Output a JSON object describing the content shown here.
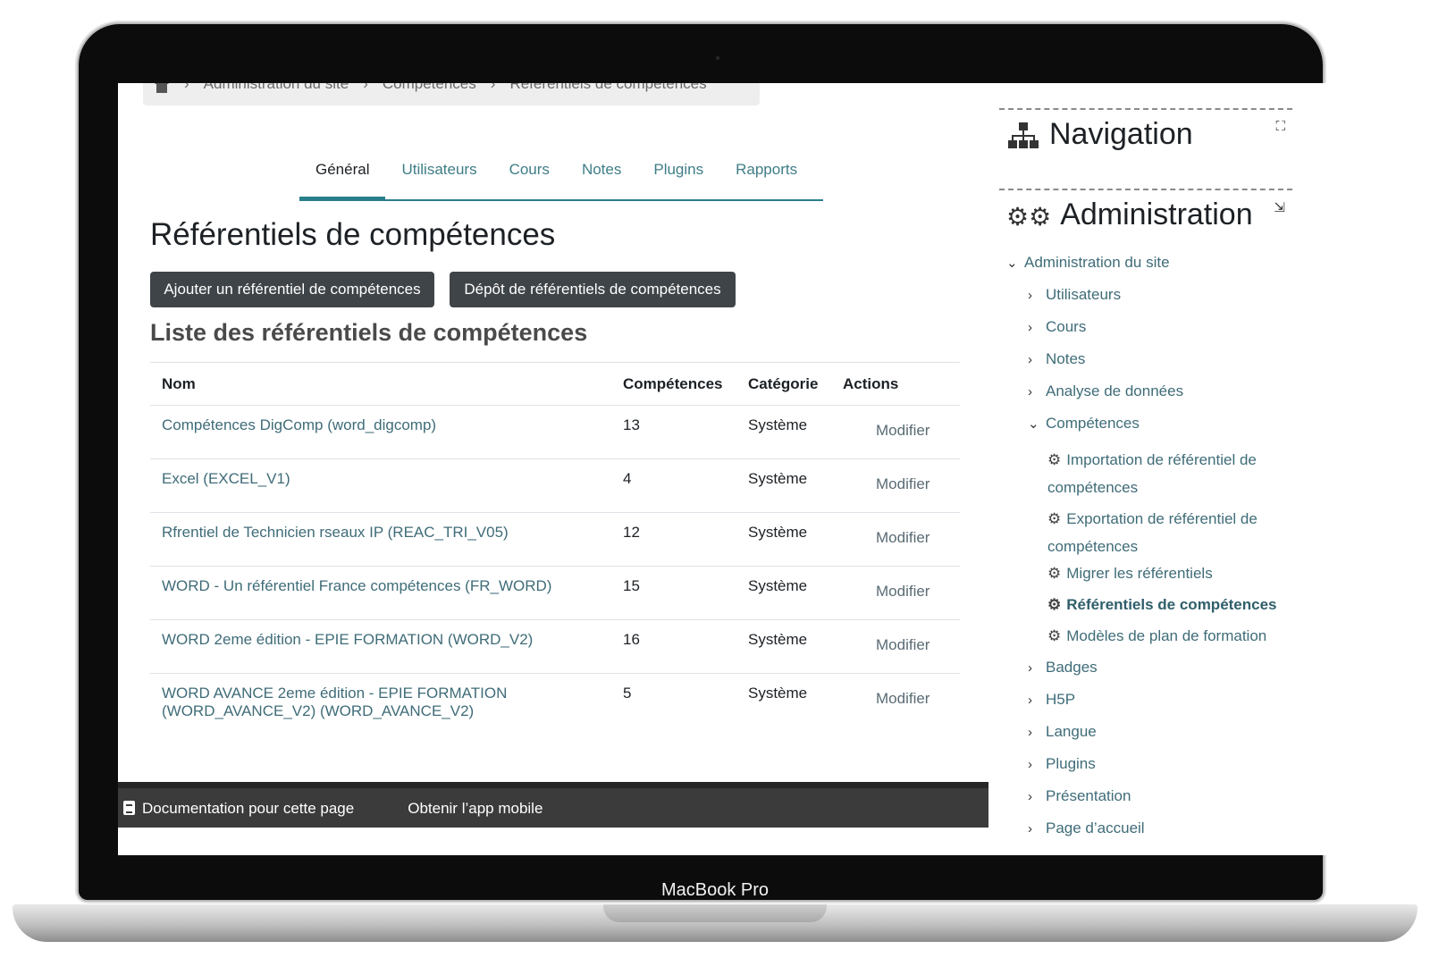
{
  "device": {
    "label": "MacBook Pro"
  },
  "breadcrumb": {
    "items": [
      "Administration du site",
      "Compétences",
      "Référentiels de compétences"
    ],
    "separator": "›"
  },
  "tabs": [
    {
      "label": "Général"
    },
    {
      "label": "Utilisateurs"
    },
    {
      "label": "Cours"
    },
    {
      "label": "Notes"
    },
    {
      "label": "Plugins"
    },
    {
      "label": "Rapports"
    }
  ],
  "main": {
    "title": "Référentiels de compétences",
    "add_button": "Ajouter un référentiel de compétences",
    "upload_button": "Dépôt de référentiels de compétences",
    "list_title": "Liste des référentiels de compétences"
  },
  "table": {
    "headers": [
      "Nom",
      "Compétences",
      "Catégorie",
      "Actions"
    ],
    "rows": [
      {
        "name": "Compétences DigComp (word_digcomp)",
        "count": "13",
        "category": "Système",
        "action": "Modifier"
      },
      {
        "name": "Excel (EXCEL_V1)",
        "count": "4",
        "category": "Système",
        "action": "Modifier"
      },
      {
        "name": "Rfrentiel de Technicien rseaux IP (REAC_TRI_V05)",
        "count": "12",
        "category": "Système",
        "action": "Modifier"
      },
      {
        "name": "WORD - Un référentiel France compétences (FR_WORD)",
        "count": "15",
        "category": "Système",
        "action": "Modifier"
      },
      {
        "name": "WORD 2eme édition - EPIE FORMATION (WORD_V2)",
        "count": "16",
        "category": "Système",
        "action": "Modifier"
      },
      {
        "name": "WORD AVANCE 2eme édition - EPIE FORMATION (WORD_AVANCE_V2) (WORD_AVANCE_V2)",
        "count": "5",
        "category": "Système",
        "action": "Modifier"
      }
    ]
  },
  "footer": {
    "doc_link": "Documentation pour cette page",
    "app_link": "Obtenir l’app mobile"
  },
  "sidebar": {
    "navigation_title": "Navigation",
    "administration_title": "Administration",
    "tree": {
      "root": "Administration du site",
      "items": [
        "Utilisateurs",
        "Cours",
        "Notes",
        "Analyse de données"
      ],
      "competences": "Compétences",
      "competences_children": [
        "Importation de référentiel de compétences",
        "Exportation de référentiel de compétences",
        "Migrer les référentiels",
        "Référentiels de compétences",
        "Modèles de plan de formation"
      ],
      "items_after": [
        "Badges",
        "H5P",
        "Langue",
        "Plugins",
        "Présentation",
        "Page d’accueil"
      ]
    }
  },
  "colors": {
    "accent": "#2a7f8a",
    "link": "#3f6c78",
    "button": "#3f4448",
    "footer": "#3b3b3b"
  }
}
